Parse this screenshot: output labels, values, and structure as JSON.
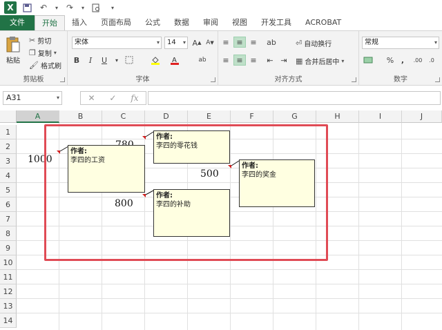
{
  "quick_access": {
    "icons": [
      "excel-logo",
      "save-icon",
      "undo-icon",
      "redo-icon",
      "print-preview-icon",
      "customize-icon"
    ],
    "excel_letter": "X"
  },
  "tabs": [
    "文件",
    "开始",
    "插入",
    "页面布局",
    "公式",
    "数据",
    "审阅",
    "视图",
    "开发工具",
    "ACROBAT"
  ],
  "active_tab": "开始",
  "ribbon": {
    "clipboard": {
      "paste": "粘贴",
      "cut": "剪切",
      "copy": "复制",
      "format_painter": "格式刷",
      "label": "剪贴板"
    },
    "font": {
      "font_name": "宋体",
      "font_size": "14",
      "bold": "B",
      "italic": "I",
      "underline": "U",
      "label": "字体"
    },
    "alignment": {
      "wrap_text": "自动换行",
      "merge_center": "合并后居中",
      "label": "对齐方式"
    },
    "number": {
      "format": "常规",
      "percent": "%",
      "comma": ",",
      "label": "数字"
    }
  },
  "formula_bar": {
    "name_box": "A31",
    "cancel": "✕",
    "enter": "✓",
    "fx": "fx",
    "formula": ""
  },
  "columns": [
    "A",
    "B",
    "C",
    "D",
    "E",
    "F",
    "G",
    "H",
    "I",
    "J"
  ],
  "rows": [
    "1",
    "2",
    "3",
    "4",
    "5",
    "6",
    "7",
    "8",
    "9",
    "10",
    "11",
    "12",
    "13",
    "14"
  ],
  "cells": {
    "A3": "1000",
    "C2": "780",
    "E4": "500",
    "C6": "800"
  },
  "comments": [
    {
      "author": "作者:",
      "text": "李四的工资"
    },
    {
      "author": "作者:",
      "text": "李四的零花钱"
    },
    {
      "author": "作者:",
      "text": "李四的奖金"
    },
    {
      "author": "作者:",
      "text": "李四的补助"
    }
  ],
  "colors": {
    "accent": "#217346",
    "highlight": "#e04b55",
    "comment_bg": "#ffffe1"
  }
}
